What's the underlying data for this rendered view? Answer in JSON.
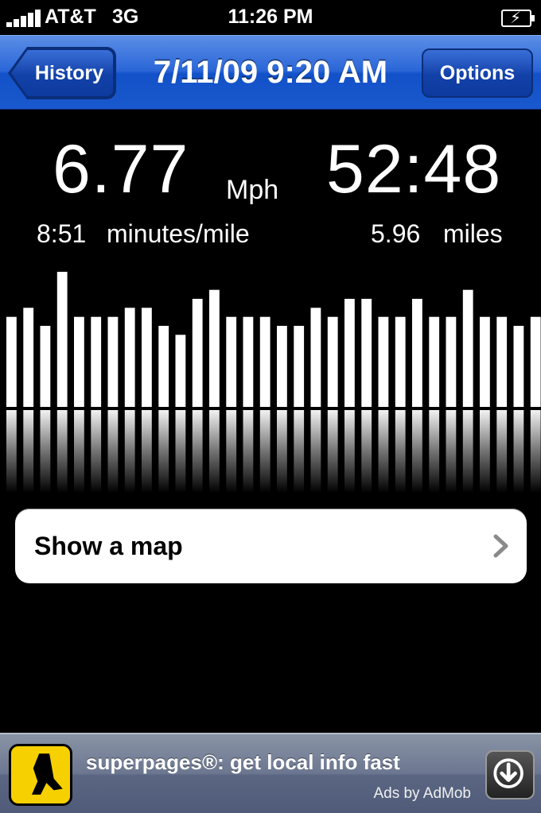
{
  "status_bar": {
    "carrier": "AT&T",
    "network": "3G",
    "time": "11:26 PM",
    "signal_bars": 5,
    "battery_icon": "battery-charging-icon"
  },
  "nav": {
    "back_label": "History",
    "title": "7/11/09 9:20 AM",
    "options_label": "Options",
    "color": "#2a66d8"
  },
  "stats": {
    "speed": "6.77",
    "speed_unit": "Mph",
    "duration": "52:48",
    "pace": "8:51",
    "pace_unit": "minutes/mile",
    "distance": "5.96",
    "distance_unit": "miles"
  },
  "chart_data": {
    "type": "bar",
    "series": [
      {
        "values": [
          10,
          11,
          9,
          15,
          10,
          10,
          10,
          11,
          11,
          9,
          8,
          12,
          13,
          10,
          10,
          10,
          9,
          9,
          11,
          10,
          12,
          12,
          10,
          10,
          12,
          10,
          10,
          13,
          10,
          10,
          9,
          10
        ]
      }
    ],
    "ylim": [
      0,
      15
    ],
    "reflection": true,
    "bar_color": "#ffffff"
  },
  "map_row": {
    "label": "Show a map",
    "chevron_icon": "chevron-right-icon"
  },
  "ad": {
    "text": "superpages®: get local info fast",
    "byline": "Ads by AdMob",
    "logo_icon": "yellow-pages-walking-fingers-icon",
    "download_icon": "download-arrow-icon",
    "logo_color": "#f6d000"
  }
}
